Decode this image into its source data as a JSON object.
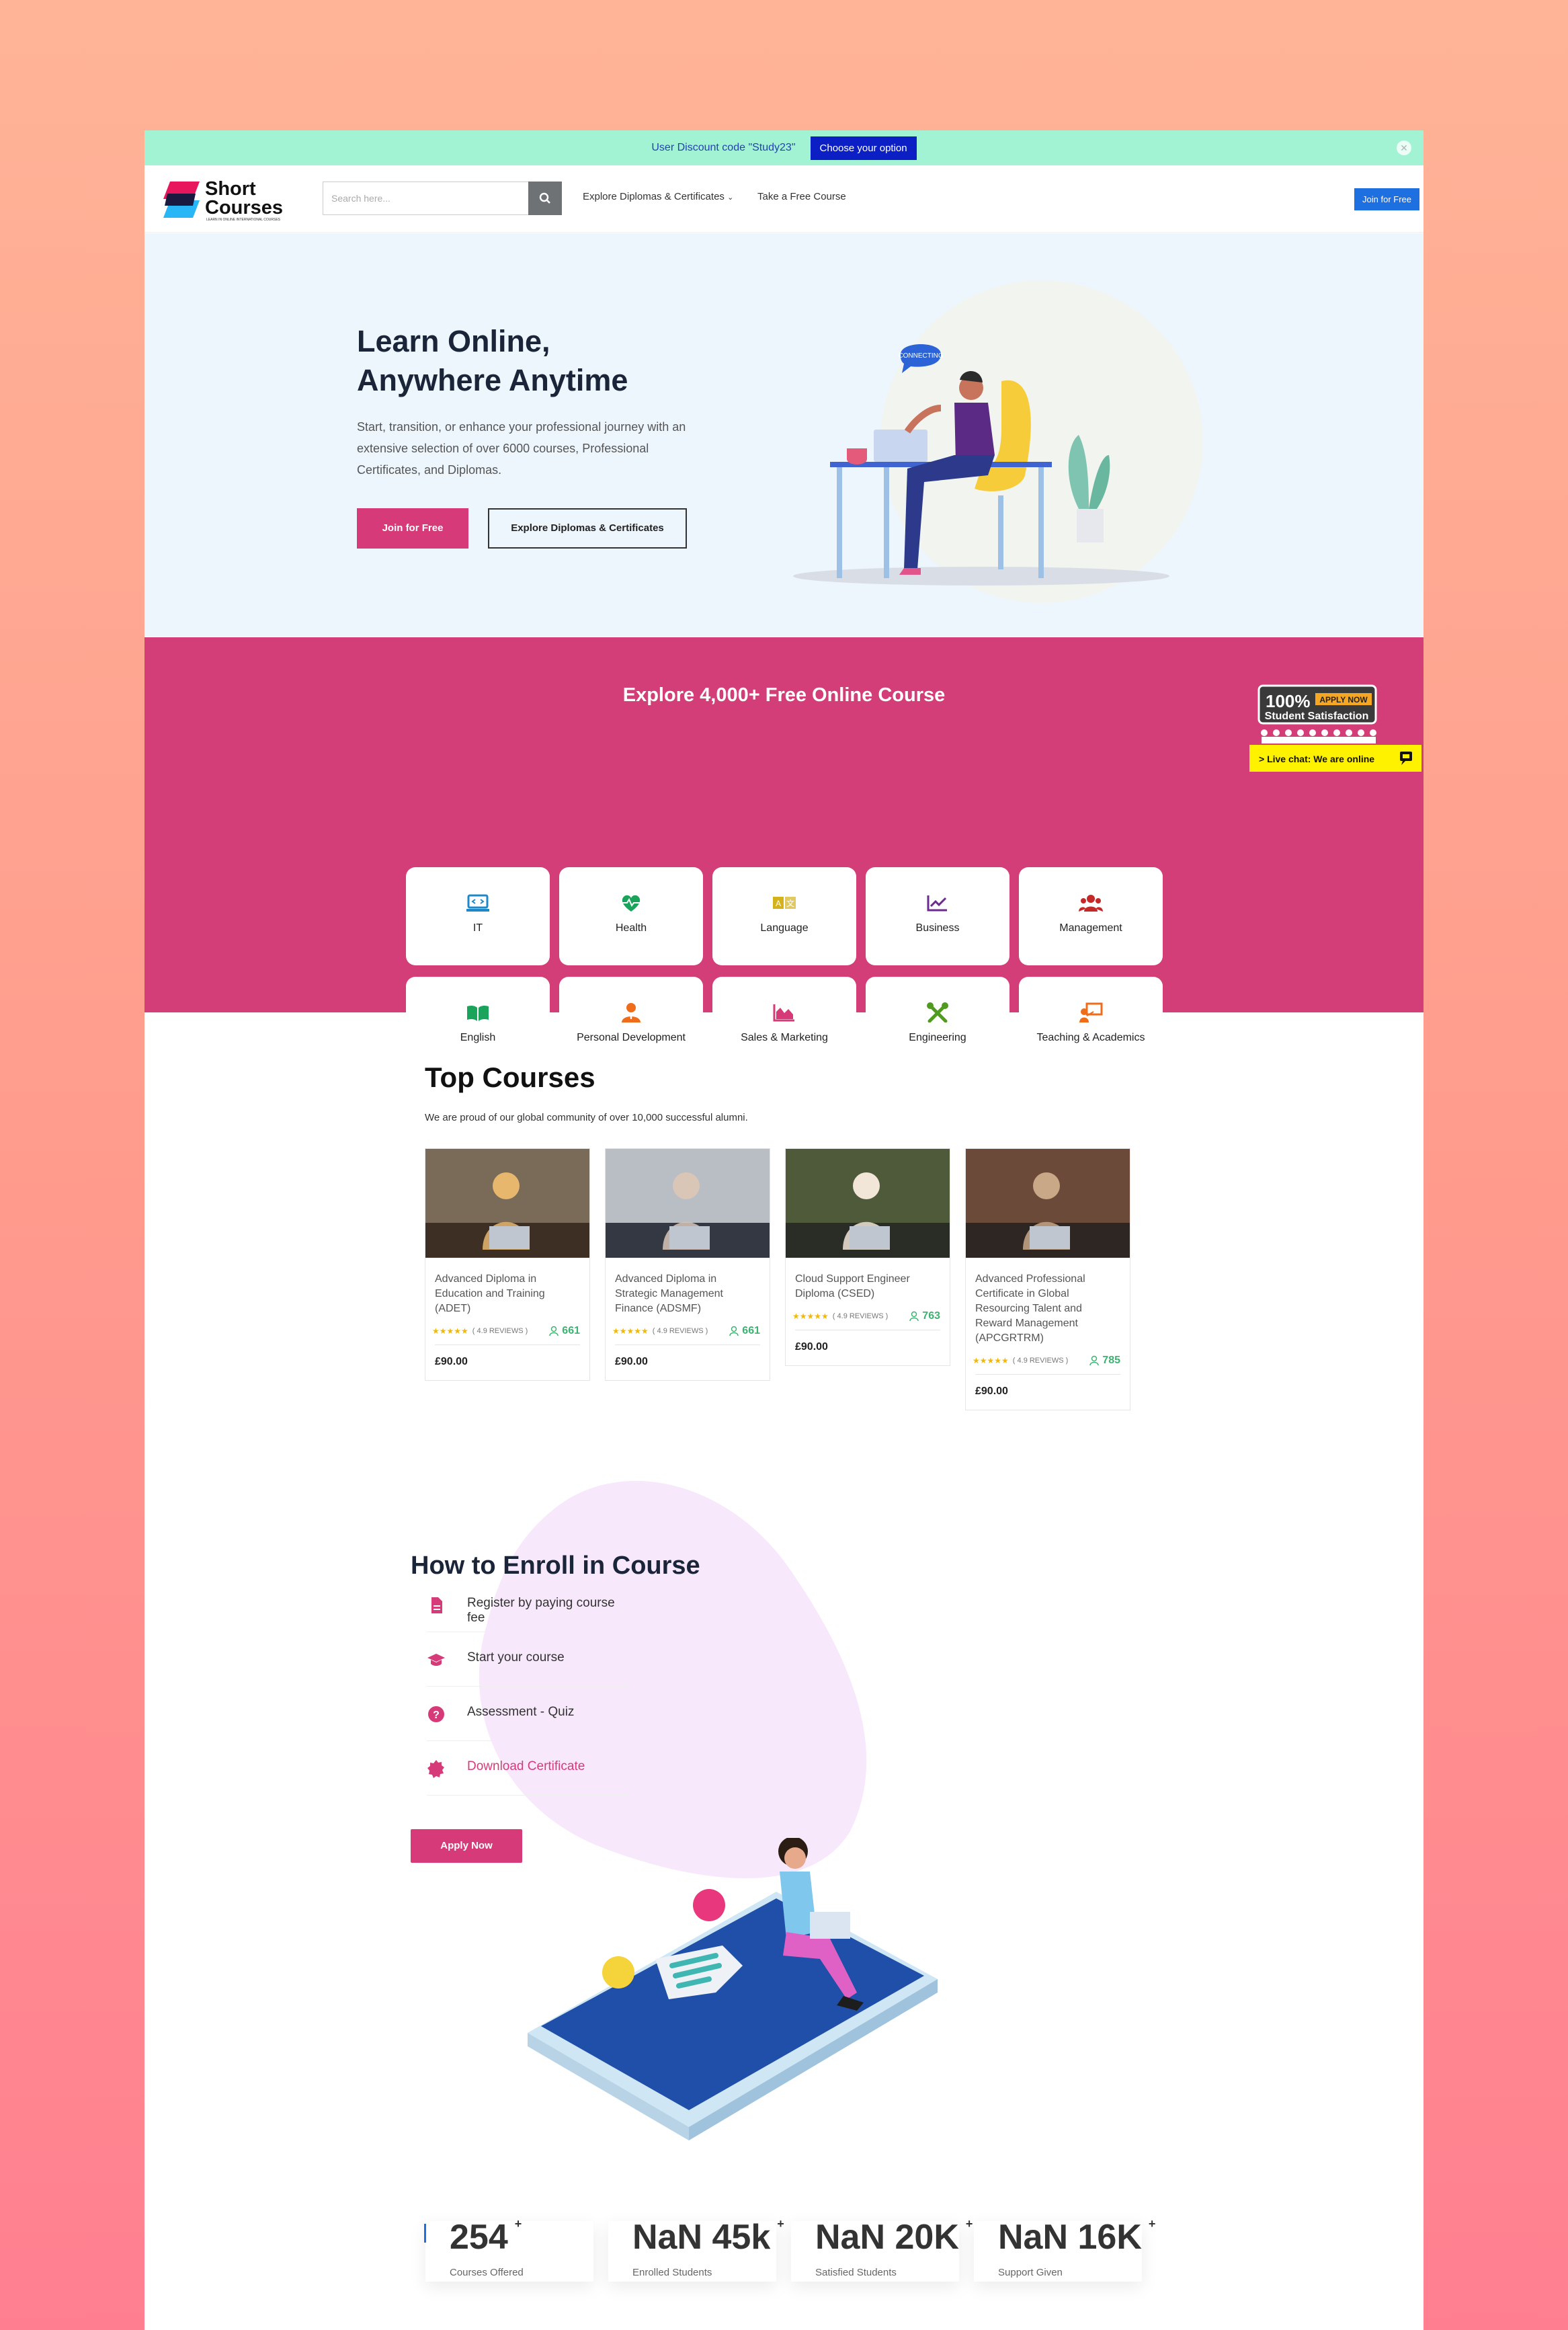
{
  "topbar": {
    "discount_text": "User Discount code \"Study23\"",
    "choose_label": "Choose your option"
  },
  "header": {
    "logo_line1": "Short",
    "logo_line2": "Courses",
    "logo_tagline": "LEARN IN ONLINE INTERNATIONAL COURSES",
    "search_placeholder": "Search here...",
    "nav_explore": "Explore Diplomas & Certificates",
    "nav_free": "Take a Free Course",
    "join_label": "Join for Free"
  },
  "hero": {
    "title_line1": "Learn Online,",
    "title_line2": "Anywhere Anytime",
    "description": "Start, transition, or enhance your professional journey with an extensive selection of over 6000 courses, Professional Certificates, and Diplomas.",
    "join_label": "Join for Free",
    "explore_label": "Explore Diplomas & Certificates",
    "bubble_text": "CONNECTING"
  },
  "categories": {
    "title": "Explore 4,000+ Free Online Course",
    "items": [
      {
        "label": "IT",
        "icon": "laptop-code-icon",
        "color": "#1e88c9"
      },
      {
        "label": "Health",
        "icon": "heartbeat-icon",
        "color": "#1aa35a"
      },
      {
        "label": "Language",
        "icon": "language-icon",
        "color": "#d4b21c"
      },
      {
        "label": "Business",
        "icon": "chart-line-icon",
        "color": "#6b2b8f"
      },
      {
        "label": "Management",
        "icon": "users-icon",
        "color": "#c62828"
      },
      {
        "label": "English",
        "icon": "book-open-icon",
        "color": "#1aa35a"
      },
      {
        "label": "Personal Development",
        "icon": "user-tie-icon",
        "color": "#ef6c1a"
      },
      {
        "label": "Sales & Marketing",
        "icon": "chart-area-icon",
        "color": "#d63a78"
      },
      {
        "label": "Engineering",
        "icon": "tools-icon",
        "color": "#4f9a1f"
      },
      {
        "label": "Teaching & Academics",
        "icon": "chalkboard-teacher-icon",
        "color": "#ef6c1a"
      }
    ],
    "badge": {
      "percent": "100%",
      "apply": "APPLY NOW",
      "satisfaction": "Student Satisfaction",
      "chat": "> Live chat: We are online"
    }
  },
  "top_courses": {
    "title": "Top Courses",
    "subtitle": "We are proud of our global community of over 10,000 successful alumni.",
    "courses": [
      {
        "title": "Advanced Diploma in Education and Training (ADET)",
        "stars": "★★★★★",
        "reviews": "( 4.9 REVIEWS )",
        "students": "661",
        "price": "£90.00"
      },
      {
        "title": "Advanced Diploma in Strategic Management Finance (ADSMF)",
        "stars": "★★★★★",
        "reviews": "( 4.9 REVIEWS )",
        "students": "661",
        "price": "£90.00"
      },
      {
        "title": "Cloud Support Engineer Diploma (CSED)",
        "stars": "★★★★★",
        "reviews": "( 4.9 REVIEWS )",
        "students": "763",
        "price": "£90.00"
      },
      {
        "title": "Advanced Professional Certificate in Global Resourcing Talent and Reward Management (APCGRTRM)",
        "stars": "★★★★★",
        "reviews": "( 4.9 REVIEWS )",
        "students": "785",
        "price": "£90.00"
      }
    ]
  },
  "enroll": {
    "title": "How to Enroll in Course",
    "steps": [
      {
        "label": "Register by paying course fee",
        "icon": "file-icon"
      },
      {
        "label": "Start your course",
        "icon": "graduation-cap-icon"
      },
      {
        "label": "Assessment - Quiz",
        "icon": "question-circle-icon"
      },
      {
        "label": "Download Certificate",
        "icon": "certificate-icon"
      }
    ],
    "apply_label": "Apply Now",
    "accent": "#d63a78"
  },
  "counters": [
    {
      "value": "254",
      "plus": "+",
      "label": "Courses Offered"
    },
    {
      "value": "NaN 45k",
      "plus": "+",
      "label": "Enrolled Students"
    },
    {
      "value": "NaN 20K",
      "plus": "+",
      "label": "Satisfied Students"
    },
    {
      "value": "NaN 16K",
      "plus": "+",
      "label": "Support Given"
    }
  ]
}
